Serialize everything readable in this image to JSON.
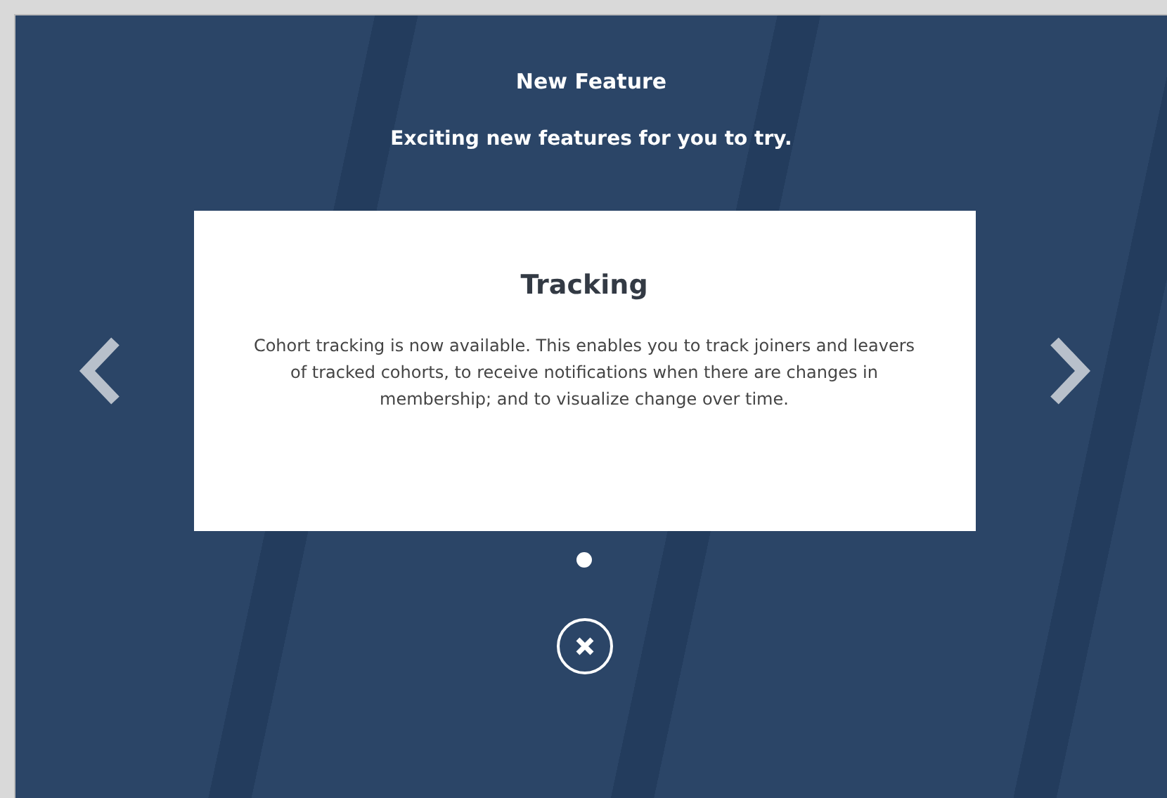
{
  "header": {
    "title": "New Feature",
    "subtitle": "Exciting new features for you to try."
  },
  "slide": {
    "title": "Tracking",
    "body": "Cohort tracking is now available. This enables you to track joiners and leavers of tracked cohorts, to receive notifications when there are changes in membership; and to visualize change over time."
  },
  "dots": [
    {
      "selected": true
    }
  ]
}
